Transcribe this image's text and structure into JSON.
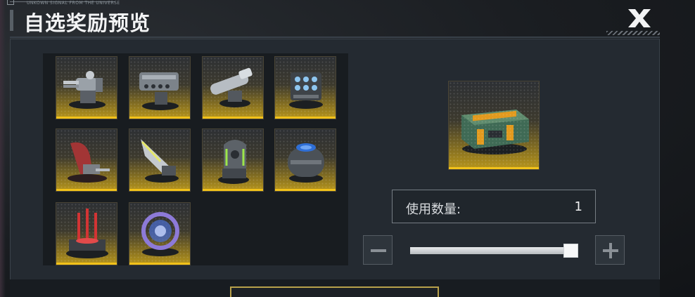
{
  "header": {
    "signal_text": "UNKOWN SIGNAL FROM THE UNIVERSE",
    "title": "自选奖励预览",
    "close_icon": "close-x-icon"
  },
  "rewards": {
    "items": [
      {
        "icon": "gatling-turret-icon"
      },
      {
        "icon": "missile-launcher-icon"
      },
      {
        "icon": "cannon-turret-icon"
      },
      {
        "icon": "cluster-launcher-icon"
      },
      {
        "icon": "red-shield-turret-icon"
      },
      {
        "icon": "blade-turret-icon"
      },
      {
        "icon": "green-energy-turret-icon"
      },
      {
        "icon": "blue-dome-turret-icon"
      },
      {
        "icon": "red-spike-turret-icon"
      },
      {
        "icon": "portal-ring-icon"
      }
    ]
  },
  "preview": {
    "icon": "supply-crate-icon"
  },
  "quantity": {
    "label": "使用数量:",
    "value": "1",
    "slider_level": 1.0,
    "minus_icon": "minus-icon",
    "plus_icon": "plus-icon"
  },
  "colors": {
    "accent_gold": "#f2c21a",
    "panel": "#242a31"
  }
}
